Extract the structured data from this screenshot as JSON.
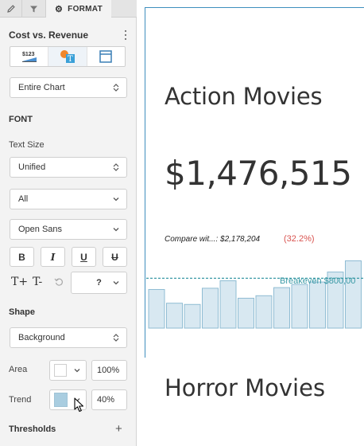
{
  "panel": {
    "tabs": {
      "format_label": "FORMAT"
    },
    "title": "Cost vs. Revenue",
    "scope_select": {
      "value": "Entire Chart"
    },
    "font": {
      "heading": "FONT",
      "text_size_label": "Text Size",
      "text_size_value": "Unified",
      "range_value": "All",
      "family_value": "Open Sans",
      "format_buttons": [
        "B",
        "I",
        "U",
        "U"
      ],
      "size_increase": "T+",
      "size_decrease": "T-",
      "size_value": "?"
    },
    "shape": {
      "heading": "Shape",
      "target_value": "Background",
      "area_label": "Area",
      "area_color": "#ffffff",
      "area_opacity": "100%",
      "trend_label": "Trend",
      "trend_color": "#a9cde0",
      "trend_opacity": "40%"
    },
    "thresholds_label": "Thresholds",
    "add_icon": "+"
  },
  "content": {
    "action_title": "Action Movies",
    "action_value": "$1,476,515",
    "compare_text": "Compare wit...: $2,178,204",
    "compare_pct": "(32.2%)",
    "breakeven_label": "Breakeven $800,00",
    "horror_title": "Horror Movies"
  },
  "colors": {
    "accent_blue": "#3f8fbe",
    "negative_red": "#d9534f",
    "breakeven_teal": "#3b9aa6",
    "bar_fill": "#d8e8f1",
    "bar_stroke": "#8fbcd3"
  },
  "chart_data": {
    "type": "bar",
    "values": [
      620,
      400,
      380,
      640,
      760,
      480,
      520,
      650,
      700,
      740,
      900,
      1080
    ],
    "ylim": [
      0,
      1150
    ],
    "reference_line": {
      "label": "Breakeven $800,00",
      "value": 800
    }
  }
}
